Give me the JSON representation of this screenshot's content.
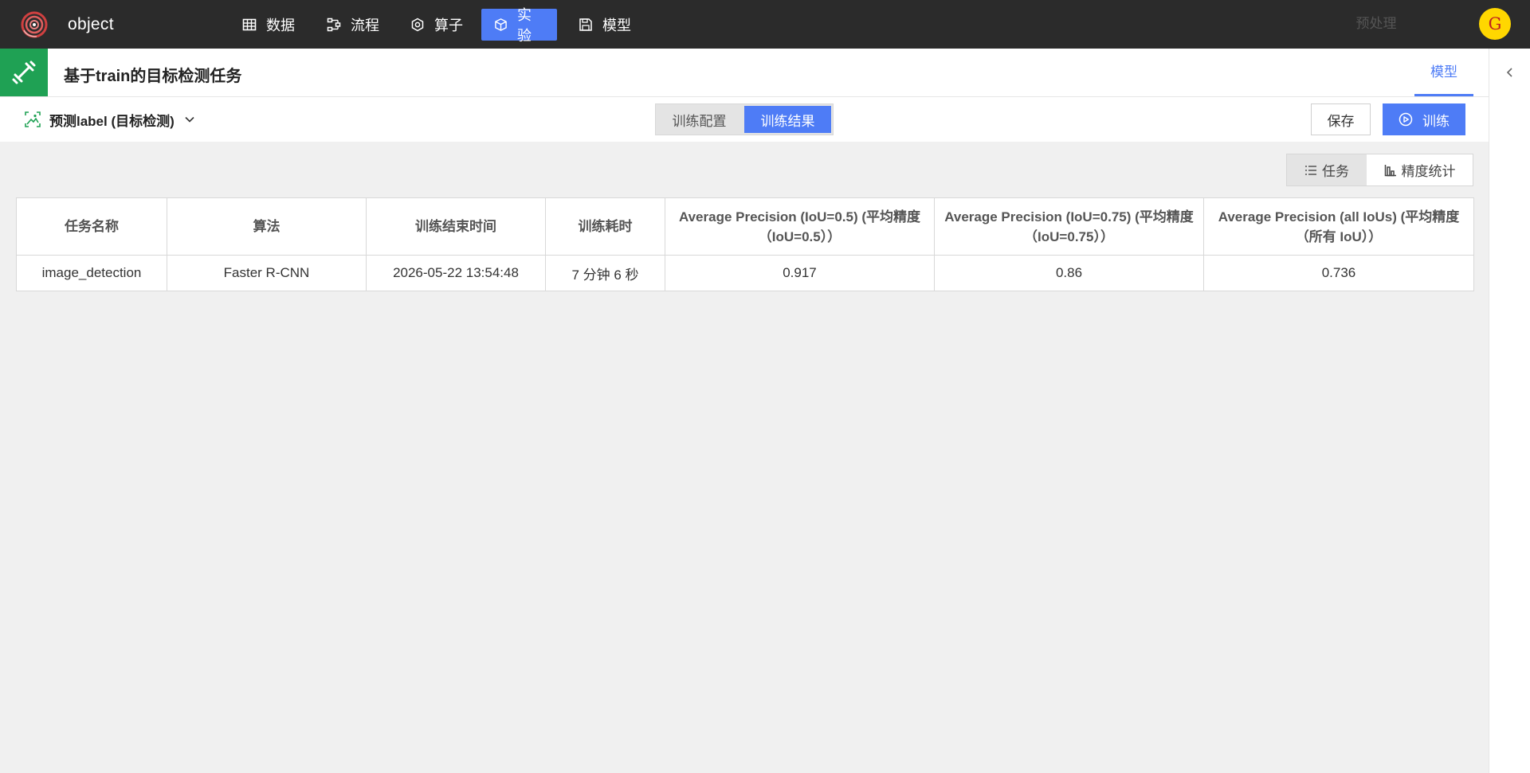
{
  "app": {
    "name": "object"
  },
  "nav": {
    "items": [
      {
        "label": "数据",
        "icon": "table-icon"
      },
      {
        "label": "流程",
        "icon": "flow-icon"
      },
      {
        "label": "算子",
        "icon": "hexagon-icon"
      },
      {
        "label": "实验",
        "icon": "cube-icon",
        "active": true
      },
      {
        "label": "模型",
        "icon": "save-icon"
      }
    ],
    "active_color": "#4e7cf6"
  },
  "user": {
    "avatar_letter": "G"
  },
  "task": {
    "title": "基于train的目标检测任务"
  },
  "right_tabs": [
    {
      "label": "预处理"
    },
    {
      "label": "模型",
      "active": true
    }
  ],
  "toolbar": {
    "target_label": "预测label (目标检测)",
    "segments": [
      {
        "label": "训练配置"
      },
      {
        "label": "训练结果",
        "active": true
      }
    ],
    "save_label": "保存",
    "train_label": "训练"
  },
  "view_toggle": [
    {
      "label": "任务",
      "icon": "list-icon"
    },
    {
      "label": "精度统计",
      "icon": "bar-chart-icon",
      "active": true
    }
  ],
  "table": {
    "headers": [
      "任务名称",
      "算法",
      "训练结束时间",
      "训练耗时",
      "Average Precision (IoU=0.5) (平均精度（IoU=0.5））",
      "Average Precision (IoU=0.75) (平均精度（IoU=0.75））",
      "Average Precision (all IoUs) (平均精度（所有 IoU））"
    ],
    "rows": [
      [
        "image_detection",
        "Faster R-CNN",
        "2026-05-22 13:54:48",
        "7 分钟 6 秒",
        "0.917",
        "0.86",
        "0.736"
      ]
    ]
  },
  "colors": {
    "accent": "#4e7cf6",
    "task_badge": "#1fa154",
    "topbar": "#2b2b2b"
  }
}
